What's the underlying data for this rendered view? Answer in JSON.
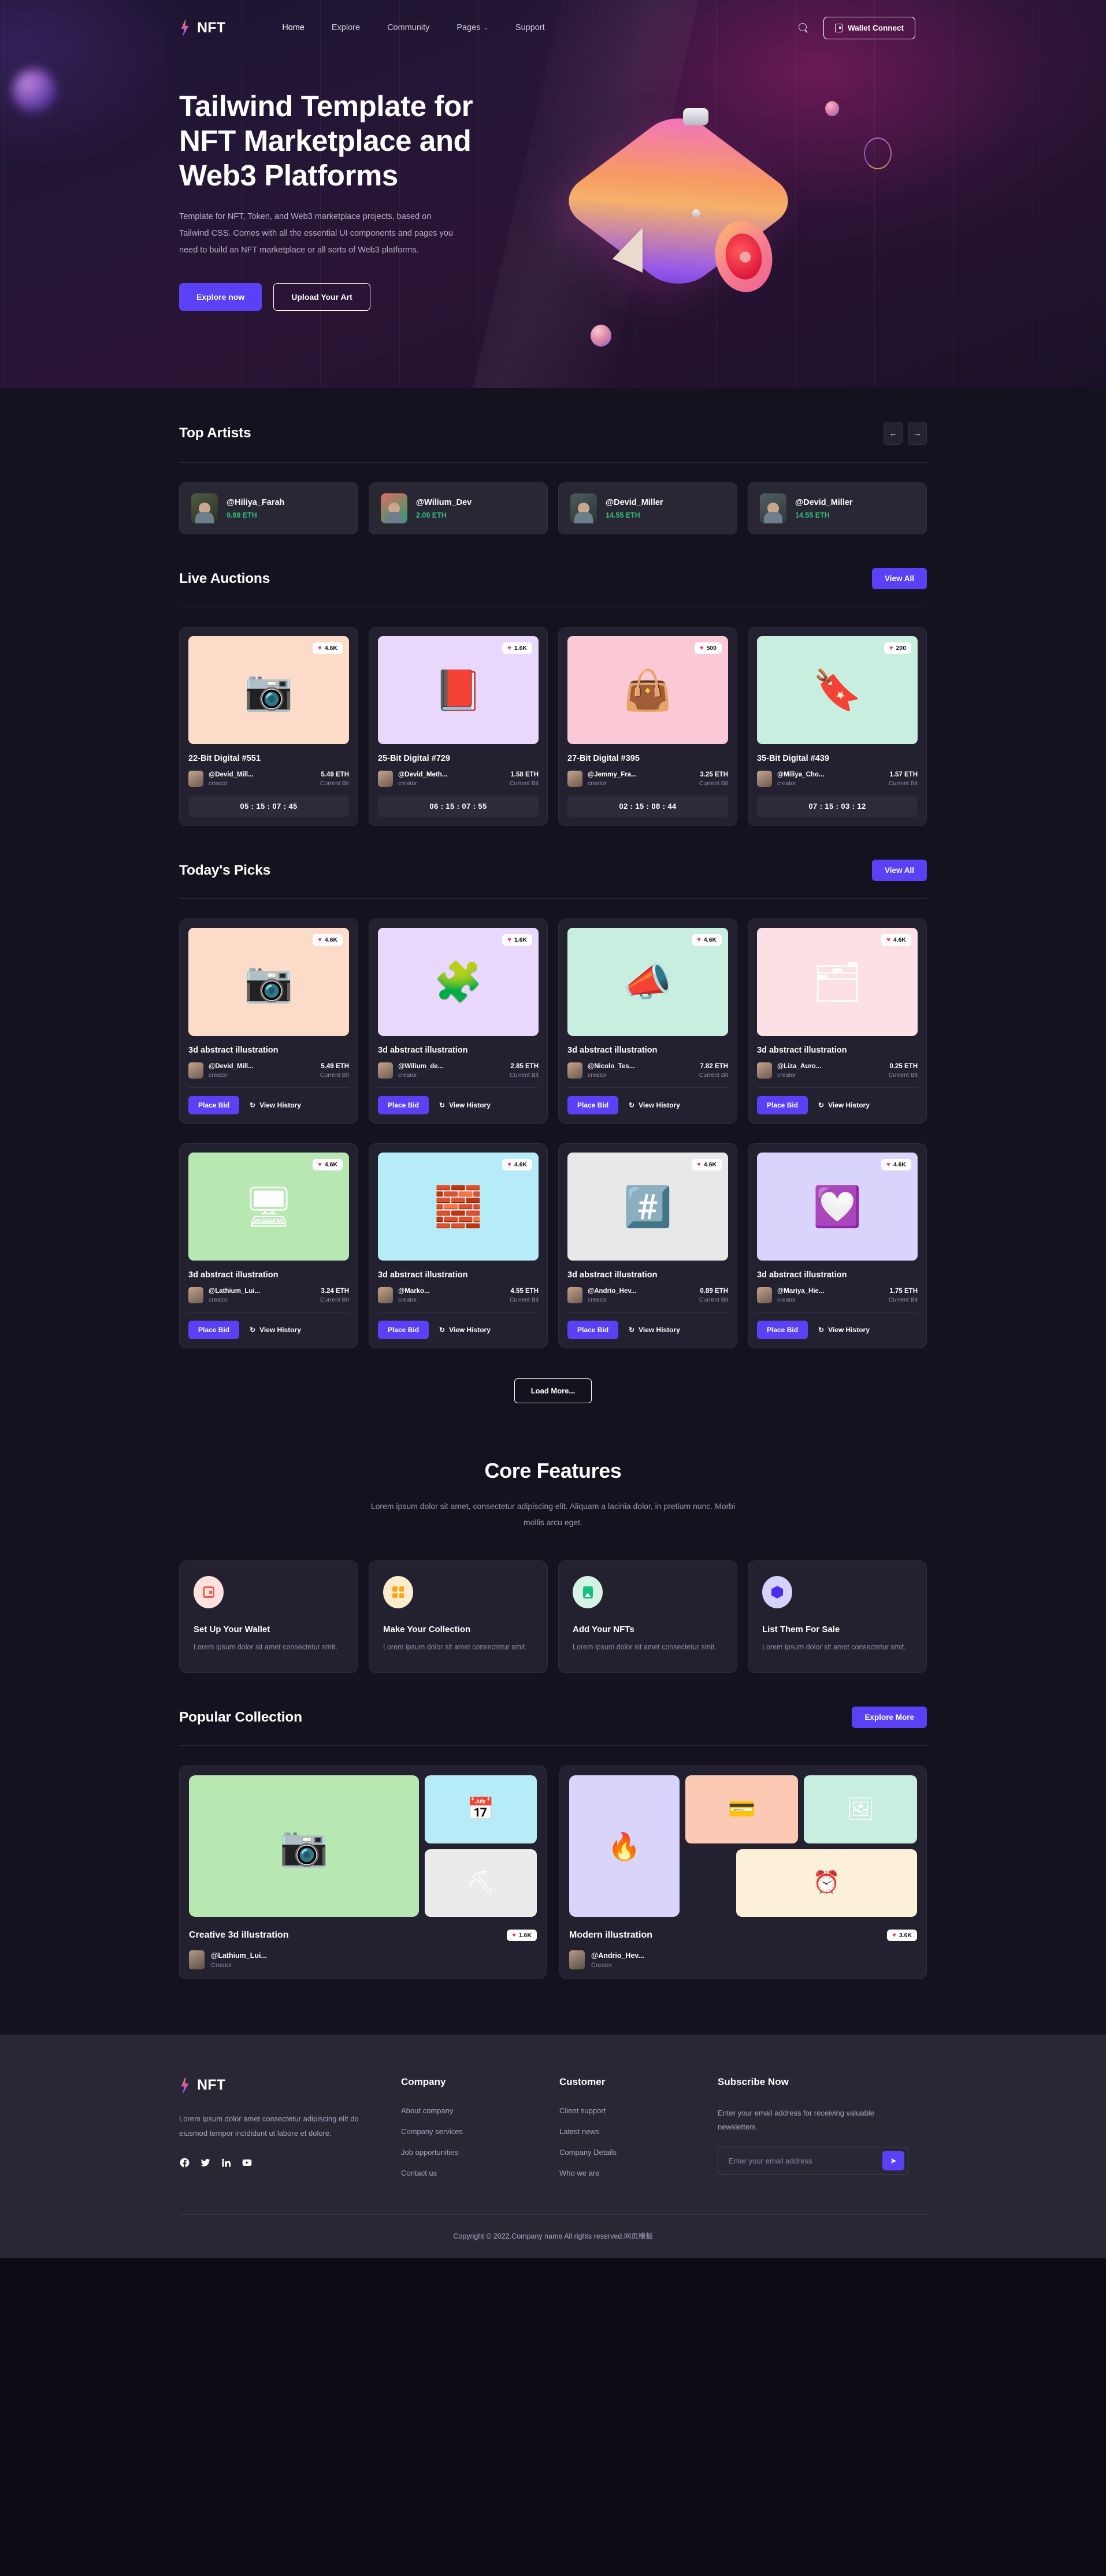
{
  "brand": {
    "name": "NFT"
  },
  "nav": {
    "links": [
      {
        "label": "Home",
        "active": true
      },
      {
        "label": "Explore",
        "active": false
      },
      {
        "label": "Community",
        "active": false
      },
      {
        "label": "Pages",
        "active": false,
        "caret": "⌄"
      },
      {
        "label": "Support",
        "active": false
      }
    ],
    "wallet_button": "Wallet Connect"
  },
  "hero": {
    "title": "Tailwind Template for NFT Marketplace and Web3 Platforms",
    "subtitle": "Template for NFT, Token, and Web3 marketplace projects, based on Tailwind CSS. Comes with all the essential UI components and pages you need to build an NFT marketplace or all sorts of Web3 platforms.",
    "primary_button": "Explore now",
    "secondary_button": "Upload Your Art"
  },
  "top_artists": {
    "title": "Top Artists",
    "prev": "←",
    "next": "→",
    "items": [
      {
        "name": "@Hiliya_Farah",
        "eth": "9.89 ETH"
      },
      {
        "name": "@Wilium_Dev",
        "eth": "2.09 ETH"
      },
      {
        "name": "@Devid_Miller",
        "eth": "14.55 ETH"
      },
      {
        "name": "@Devid_Miller",
        "eth": "14.55 ETH"
      }
    ]
  },
  "live_auctions": {
    "title": "Live Auctions",
    "view_all": "View All",
    "items": [
      {
        "title": "22-Bit Digital #551",
        "likes": "4.6K",
        "creator": "@Devid_Mill...",
        "role": "creator",
        "eth": "5.49 ETH",
        "bid_label": "Current Bit",
        "timer": "05 : 15 : 07 : 45",
        "bg": "#fcdcc8",
        "emoji": "📷"
      },
      {
        "title": "25-Bit Digital #729",
        "likes": "1.6K",
        "creator": "@Devid_Meth...",
        "role": "creator",
        "eth": "1.58 ETH",
        "bid_label": "Current Bit",
        "timer": "06 : 15 : 07 : 55",
        "bg": "#e8d8fc",
        "emoji": "📕"
      },
      {
        "title": "27-Bit Digital #395",
        "likes": "500",
        "creator": "@Jemmy_Fra...",
        "role": "creator",
        "eth": "3.25 ETH",
        "bid_label": "Current Bit",
        "timer": "02 : 15 : 08 : 44",
        "bg": "#fbc9d5",
        "emoji": "👜"
      },
      {
        "title": "35-Bit Digital #439",
        "likes": "200",
        "creator": "@Miliya_Cho...",
        "role": "creator",
        "eth": "1.57 ETH",
        "bid_label": "Current Bit",
        "timer": "07 : 15 : 03 : 12",
        "bg": "#c8eee0",
        "emoji": "🔖"
      }
    ]
  },
  "todays_picks": {
    "title": "Today's Picks",
    "view_all": "View All",
    "place_bid": "Place Bid",
    "view_history": "View History",
    "refresh_icon": "↻",
    "load_more": "Load More...",
    "items": [
      {
        "title": "3d abstract illustration",
        "likes": "4.6K",
        "creator": "@Devid_Mill...",
        "role": "creator",
        "eth": "5.49 ETH",
        "bid_label": "Current Bit",
        "bg": "#fcdcc8",
        "emoji": "📷"
      },
      {
        "title": "3d abstract illustration",
        "likes": "1.6K",
        "creator": "@Wilium_de...",
        "role": "creator",
        "eth": "2.85 ETH",
        "bid_label": "Current Bit",
        "bg": "#e8d8fc",
        "emoji": "🧩"
      },
      {
        "title": "3d abstract illustration",
        "likes": "4.6K",
        "creator": "@Nicolo_Tes...",
        "role": "creator",
        "eth": "7.82 ETH",
        "bid_label": "Current Bit",
        "bg": "#c8eee0",
        "emoji": "📣"
      },
      {
        "title": "3d abstract illustration",
        "likes": "4.6K",
        "creator": "@Liza_Auro...",
        "role": "creator",
        "eth": "0.25 ETH",
        "bid_label": "Current Bit",
        "bg": "#fce0e6",
        "emoji": "🗂"
      },
      {
        "title": "3d abstract illustration",
        "likes": "4.6K",
        "creator": "@Lathium_Lui...",
        "role": "creator",
        "eth": "3.24 ETH",
        "bid_label": "Current Bit",
        "bg": "#b7e8b2",
        "emoji": "🖥"
      },
      {
        "title": "3d abstract illustration",
        "likes": "4.6K",
        "creator": "@Marko...",
        "role": "creator",
        "eth": "4.55 ETH",
        "bid_label": "Current Bit",
        "bg": "#b6ecf7",
        "emoji": "🧱"
      },
      {
        "title": "3d abstract illustration",
        "likes": "4.6K",
        "creator": "@Andrio_Hev...",
        "role": "creator",
        "eth": "0.89 ETH",
        "bid_label": "Current Bit",
        "bg": "#e8e8e8",
        "emoji": "️#️⃣"
      },
      {
        "title": "3d abstract illustration",
        "likes": "4.6K",
        "creator": "@Mariya_Hie...",
        "role": "creator",
        "eth": "1.75 ETH",
        "bid_label": "Current Bit",
        "bg": "#d8d4fb",
        "emoji": "💟"
      }
    ]
  },
  "core_features": {
    "title": "Core Features",
    "subtitle": "Lorem ipsum dolor sit amet, consectetur adipiscing elit. Aliquam a lacinia dolor, in pretium nunc. Morbi mollis arcu eget.",
    "items": [
      {
        "name": "Set Up Your Wallet",
        "desc": "Lorem ipsum dolor sit amet consectetur smit.",
        "icon": "wallet-icon",
        "bg": "#fbe2dc",
        "fg": "#f25d52"
      },
      {
        "name": "Make Your Collection",
        "desc": "Lorem ipsum dolor sit amet consectetur smit.",
        "icon": "grid-icon",
        "bg": "#faeccb",
        "fg": "#f0a81c"
      },
      {
        "name": "Add Your NFTs",
        "desc": "Lorem ipsum dolor sit amet consectetur smit.",
        "icon": "image-icon",
        "bg": "#d4f3e4",
        "fg": "#17c07f"
      },
      {
        "name": "List Them For Sale",
        "desc": "Lorem ipsum dolor sit amet consectetur smit.",
        "icon": "tag-icon",
        "bg": "#d7d2fb",
        "fg": "#4a2ef0"
      }
    ]
  },
  "popular_collection": {
    "title": "Popular Collection",
    "explore_more": "Explore More",
    "items": [
      {
        "title": "Creative 3d illustration",
        "likes": "1.6K",
        "creator": "@Lathium_Lui...",
        "role": "Creator",
        "tiles": [
          {
            "bg": "#b7e8b2",
            "emoji": "📷"
          },
          {
            "bg": "#b6ecf7",
            "emoji": "📅"
          },
          {
            "bg": "#ebebeb",
            "emoji": "⛏"
          }
        ]
      },
      {
        "title": "Modern illustration",
        "likes": "3.6K",
        "creator": "@Andrio_Hev...",
        "role": "Creator",
        "tiles": [
          {
            "bg": "#d8d4fb",
            "emoji": "🔥"
          },
          {
            "bg": "#fcc9b4",
            "emoji": "💳"
          },
          {
            "bg": "#c8eee0",
            "emoji": "🖼"
          },
          {
            "bg": "#fdf0d8",
            "emoji": "⏰"
          }
        ]
      }
    ]
  },
  "footer": {
    "brand": "NFT",
    "description": "Lorem ipsum dolor amet consectetur adipiscing elit do eiusmod tempor incididunt ut labore et dolore.",
    "socials": [
      "facebook-icon",
      "twitter-icon",
      "linkedin-icon",
      "youtube-icon"
    ],
    "company": {
      "heading": "Company",
      "links": [
        "About company",
        "Company services",
        "Job opportunities",
        "Contact us"
      ]
    },
    "customer": {
      "heading": "Customer",
      "links": [
        "Client support",
        "Latest news",
        "Company Details",
        "Who we are"
      ]
    },
    "subscribe": {
      "heading": "Subscribe Now",
      "description": "Enter your email address for receiving valuable newsletters.",
      "placeholder": "Enter your email address",
      "value": "",
      "send_icon": "➤"
    },
    "copyright": "Copyright © 2022.Company name All rights reserved.网页模板"
  },
  "colors": {
    "accent": "#5a41f5",
    "page_bg": "#14121e",
    "card_bg": "#232130",
    "eth_green": "#2fbf7a",
    "heart_pink": "#f0346c"
  }
}
